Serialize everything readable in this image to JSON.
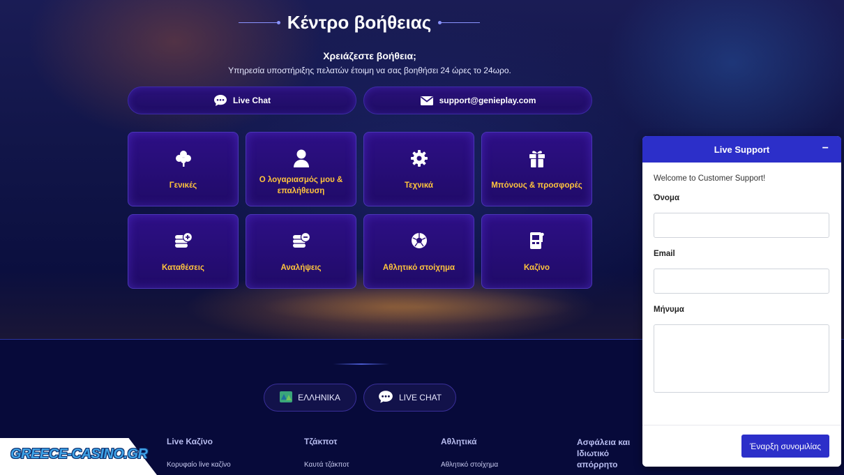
{
  "help_center": {
    "title": "Κέντρο βοήθειας",
    "subtitle": "Χρειάζεστε βοήθεια;",
    "description": "Υπηρεσία υποστήριξης πελατών έτοιμη να σας βοηθήσει 24 ώρες το 24ωρο.",
    "live_chat_label": "Live Chat",
    "email_label": "support@genieplay.com",
    "categories": [
      {
        "label": "Γενικές",
        "icon": "clover-icon"
      },
      {
        "label": "Ο λογαριασμός μου & επαλήθευση",
        "icon": "user-icon"
      },
      {
        "label": "Τεχνικά",
        "icon": "gear-icon"
      },
      {
        "label": "Μπόνους & προσφορές",
        "icon": "gift-icon"
      },
      {
        "label": "Καταθέσεις",
        "icon": "coins-plus-icon"
      },
      {
        "label": "Αναλήψεις",
        "icon": "coins-minus-icon"
      },
      {
        "label": "Αθλητικό στοίχημα",
        "icon": "soccer-ball-icon"
      },
      {
        "label": "Καζίνο",
        "icon": "slot-machine-icon"
      }
    ]
  },
  "footer": {
    "language_label": "ΕΛΛΗΝΙΚΑ",
    "live_chat_label": "LIVE CHAT",
    "columns": [
      {
        "title": "Live Καζίνο",
        "link": "Κορυφαίο live καζίνο"
      },
      {
        "title": "Τζάκποτ",
        "link": "Καυτά τζάκποτ"
      },
      {
        "title": "Αθλητικά",
        "link": "Αθλητικό στοίχημα"
      },
      {
        "title": "Ασφάλεια και Ιδιωτικό απόρρητο",
        "link": ""
      }
    ],
    "logo_text": "GREECE-CASINO.GR"
  },
  "live_support": {
    "header": "Live Support",
    "minimize_label": "−",
    "welcome": "Welcome to Customer Support!",
    "name_label": "Όνομα",
    "email_label": "Email",
    "message_label": "Μήνυμα",
    "start_button": "Έναρξη συνομιλίας"
  },
  "colors": {
    "accent": "#2c2fc9",
    "card_label": "#ffc43d",
    "background": "#070a3a"
  }
}
